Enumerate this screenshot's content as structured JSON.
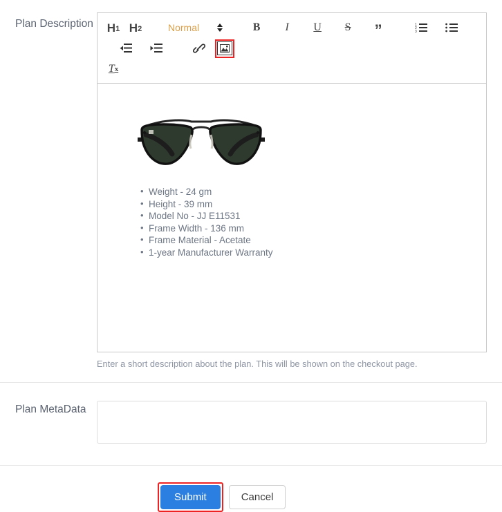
{
  "form": {
    "description_label": "Plan Description",
    "metadata_label": "Plan MetaData",
    "help_text": "Enter a short description about the plan. This will be shown on the checkout page.",
    "metadata_value": "",
    "metadata_placeholder": ""
  },
  "toolbar": {
    "h1_label": "H",
    "h1_sub": "1",
    "h2_label": "H",
    "h2_sub": "2",
    "format_picker": "Normal",
    "bold_label": "B",
    "italic_label": "I",
    "underline_label": "U",
    "strike_label": "S",
    "quote_label": "”",
    "clear_label": "T",
    "clear_sub": "x",
    "icons": {
      "ordered_list": "ordered-list-icon",
      "bullet_list": "bullet-list-icon",
      "outdent": "outdent-icon",
      "indent": "indent-icon",
      "link": "link-icon",
      "image": "image-icon",
      "picker_caret": "chevron-updown-icon"
    }
  },
  "editor_content": {
    "image_alt": "aviator-sunglasses",
    "bullets": [
      "Weight - 24 gm",
      "Height - 39 mm",
      "Model No - JJ E11531",
      "Frame Width - 136 mm",
      "Frame Material - Acetate",
      "1-year Manufacturer Warranty"
    ]
  },
  "actions": {
    "submit_label": "Submit",
    "cancel_label": "Cancel"
  },
  "colors": {
    "submit_blue": "#2a7fe0",
    "highlight_red": "#ee2222",
    "picker_orange": "#d9a04a",
    "label_gray": "#5a6270",
    "body_text_gray": "#6d7684",
    "help_text_gray": "#8e95a3",
    "lens_green": "#2f3a2e"
  }
}
